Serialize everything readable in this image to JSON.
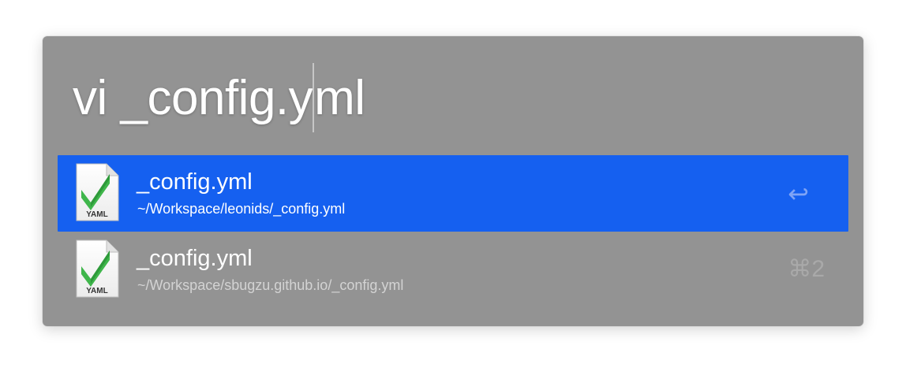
{
  "search": {
    "query_before_caret": "vi _config.y",
    "query_after_caret": "ml"
  },
  "results": [
    {
      "title": "_config.yml",
      "subtitle": "~/Workspace/leonids/_config.yml",
      "icon_label": "YAML",
      "icon": "yaml-file-icon",
      "shortcut": "↩",
      "selected": true
    },
    {
      "title": "_config.yml",
      "subtitle": "~/Workspace/sbugzu.github.io/_config.yml",
      "icon_label": "YAML",
      "icon": "yaml-file-icon",
      "shortcut": "⌘2",
      "selected": false
    }
  ],
  "colors": {
    "panel": "#939393",
    "selection": "#1560f0",
    "icon_check": "#3fb64b"
  }
}
